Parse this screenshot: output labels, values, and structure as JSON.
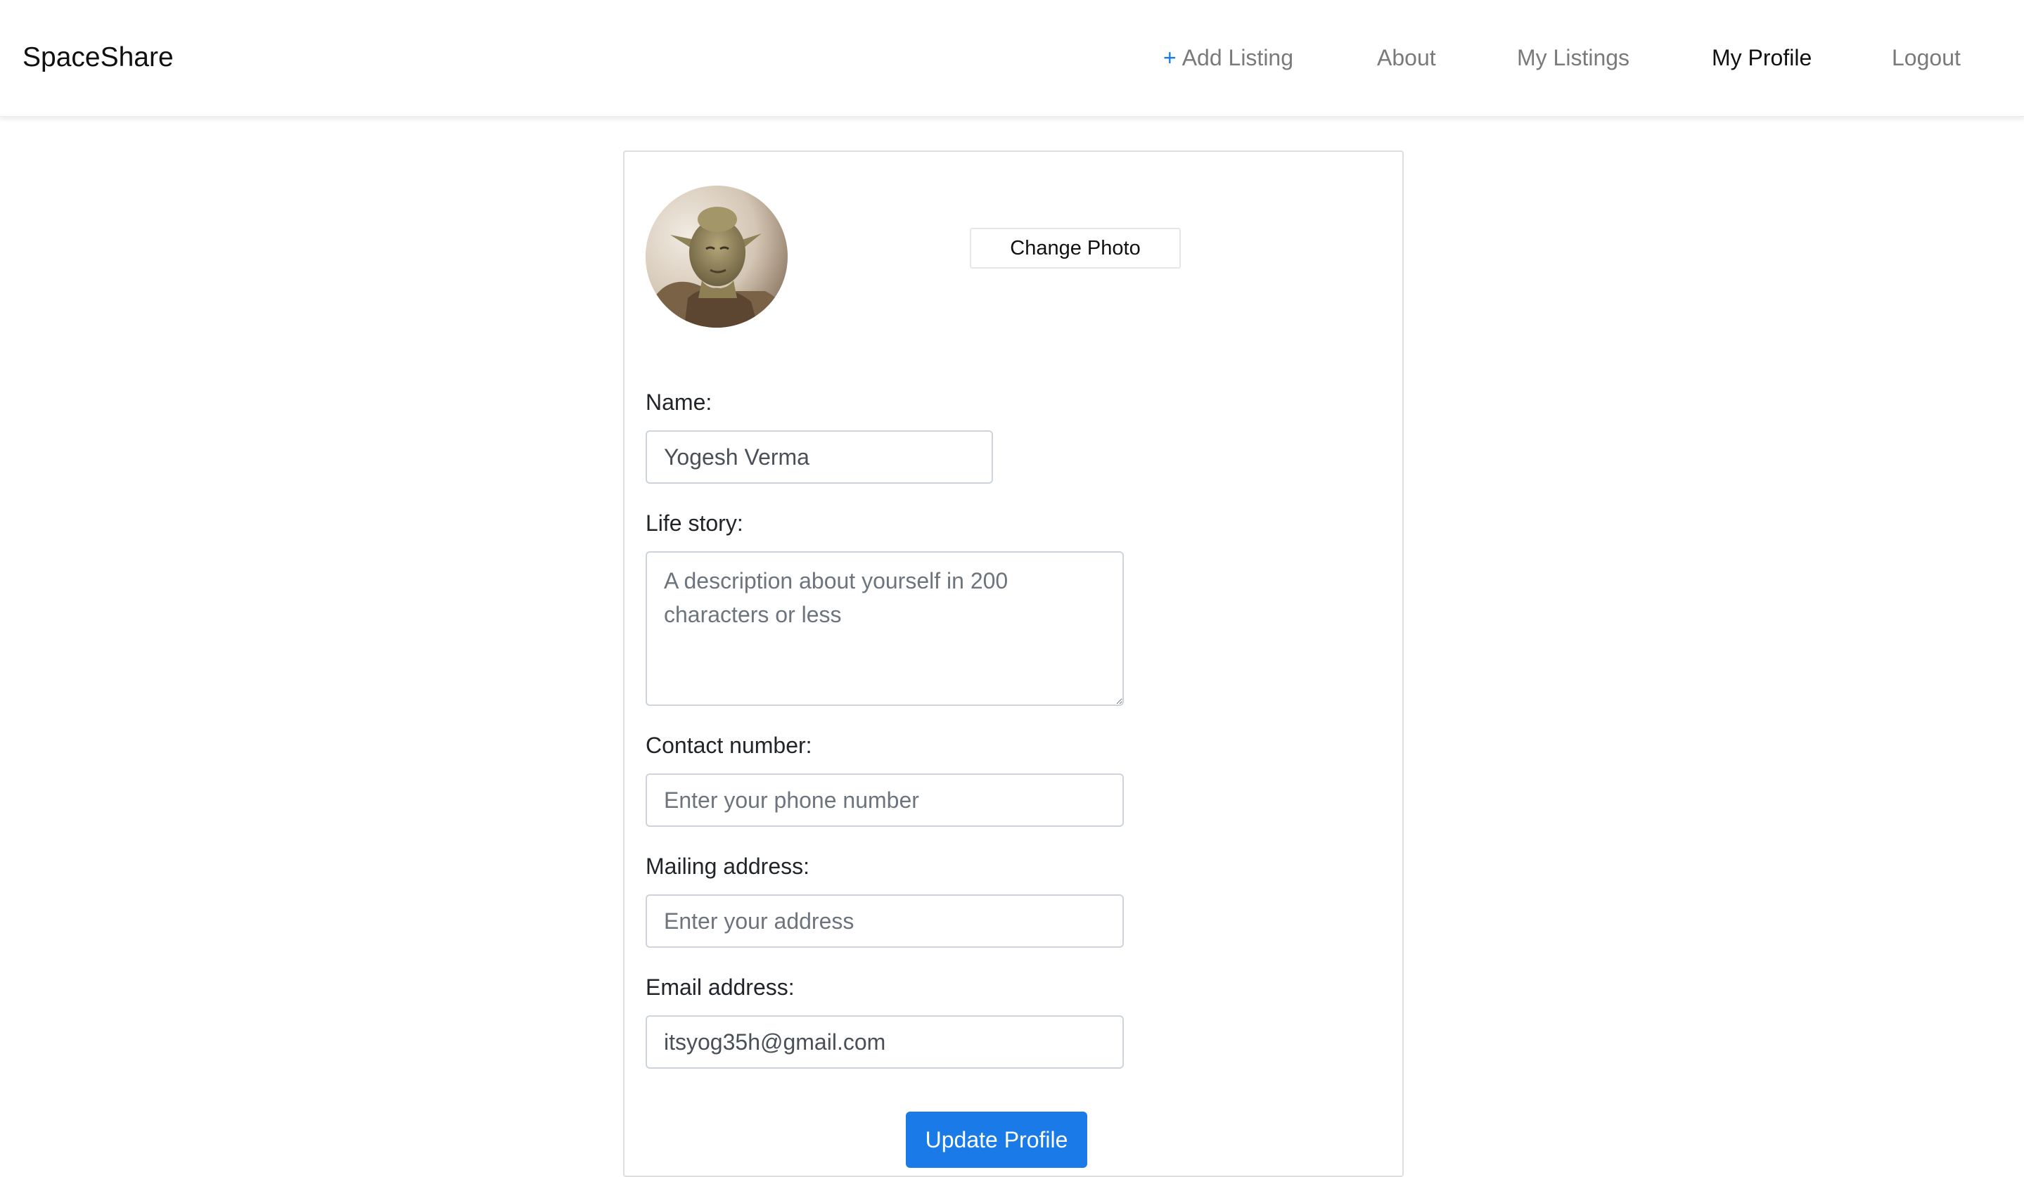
{
  "nav": {
    "brand": "SpaceShare",
    "add_listing_plus": "+",
    "add_listing": "Add Listing",
    "about": "About",
    "my_listings": "My Listings",
    "my_profile": "My Profile",
    "logout": "Logout"
  },
  "profile": {
    "change_photo": "Change Photo",
    "name_label": "Name:",
    "name_value": "Yogesh Verma",
    "life_story_label": "Life story:",
    "life_story_placeholder": "A description about yourself in 200 characters or less",
    "contact_label": "Contact number:",
    "contact_placeholder": "Enter your phone number",
    "mailing_label": "Mailing address:",
    "mailing_placeholder": "Enter your address",
    "email_label": "Email address:",
    "email_value": "itsyog35h@gmail.com",
    "submit": "Update Profile"
  },
  "colors": {
    "accent": "#1a7be8",
    "nav_inactive": "#7a7a7a",
    "nav_active": "#111111"
  }
}
